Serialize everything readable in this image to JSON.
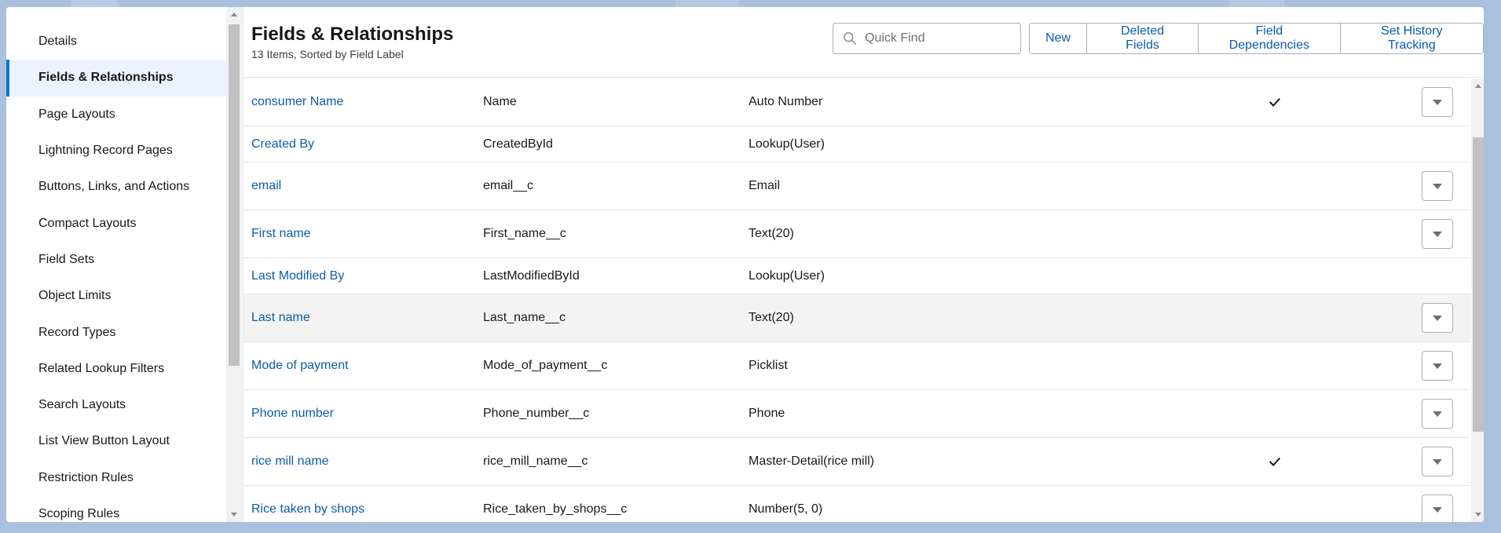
{
  "sidebar": {
    "items": [
      {
        "label": "Details"
      },
      {
        "label": "Fields & Relationships"
      },
      {
        "label": "Page Layouts"
      },
      {
        "label": "Lightning Record Pages"
      },
      {
        "label": "Buttons, Links, and Actions"
      },
      {
        "label": "Compact Layouts"
      },
      {
        "label": "Field Sets"
      },
      {
        "label": "Object Limits"
      },
      {
        "label": "Record Types"
      },
      {
        "label": "Related Lookup Filters"
      },
      {
        "label": "Search Layouts"
      },
      {
        "label": "List View Button Layout"
      },
      {
        "label": "Restriction Rules"
      },
      {
        "label": "Scoping Rules"
      }
    ],
    "active_item": "Fields & Relationships"
  },
  "header": {
    "title": "Fields & Relationships",
    "subtitle": "13 Items, Sorted by Field Label",
    "search_placeholder": "Quick Find",
    "buttons": {
      "new": "New",
      "deleted_fields": "Deleted Fields",
      "field_dependencies": "Field Dependencies",
      "set_history_tracking": "Set History Tracking"
    }
  },
  "table": {
    "rows": [
      {
        "label": "consumer Name",
        "api": "Name",
        "type": "Auto Number"
      },
      {
        "label": "Created By",
        "api": "CreatedById",
        "type": "Lookup(User)"
      },
      {
        "label": "email",
        "api": "email__c",
        "type": "Email"
      },
      {
        "label": "First name",
        "api": "First_name__c",
        "type": "Text(20)"
      },
      {
        "label": "Last Modified By",
        "api": "LastModifiedById",
        "type": "Lookup(User)"
      },
      {
        "label": "Last name",
        "api": "Last_name__c",
        "type": "Text(20)"
      },
      {
        "label": "Mode of payment",
        "api": "Mode_of_payment__c",
        "type": "Picklist"
      },
      {
        "label": "Phone number",
        "api": "Phone_number__c",
        "type": "Phone"
      },
      {
        "label": "rice mill name",
        "api": "rice_mill_name__c",
        "type": "Master-Detail(rice mill)"
      },
      {
        "label": "Rice taken by shops",
        "api": "Rice_taken_by_shops__c",
        "type": "Number(5, 0)"
      }
    ]
  },
  "colors": {
    "link": "#0b5cab",
    "active_border": "#0176d3",
    "active_bg": "#eaf3fd"
  }
}
